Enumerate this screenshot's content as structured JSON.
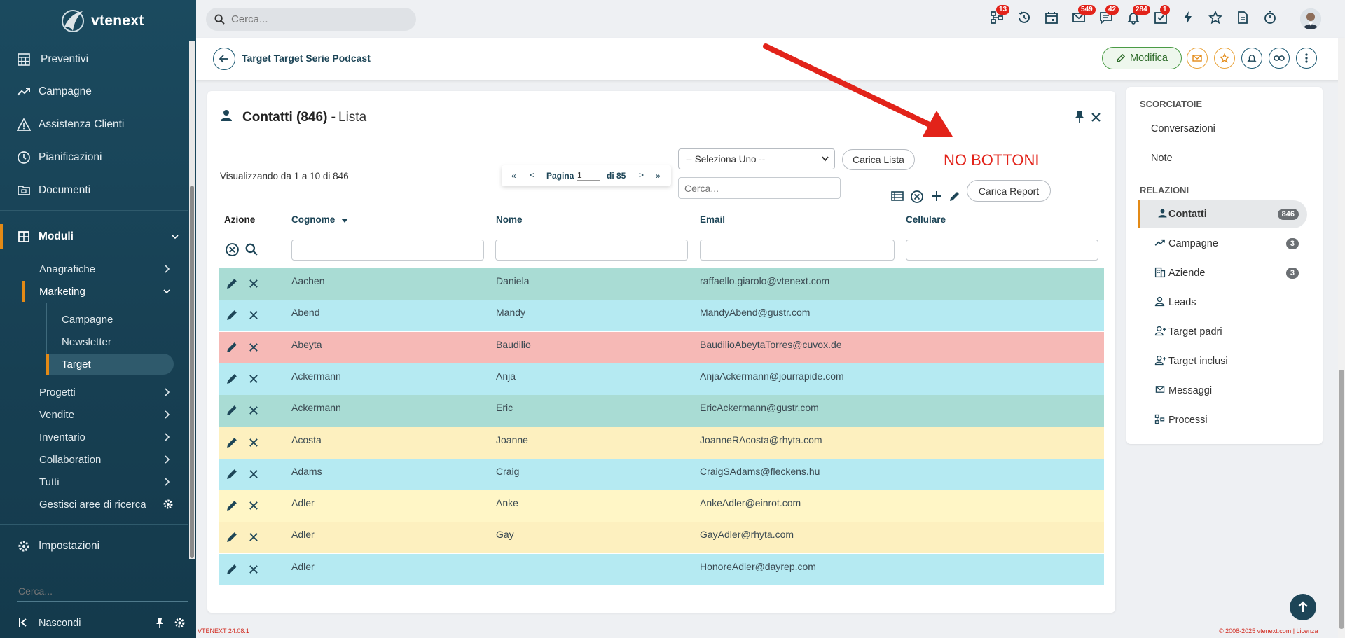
{
  "sidebar": {
    "logo": "vtenext",
    "items": [
      {
        "label": "Preventivi"
      },
      {
        "label": "Campagne"
      },
      {
        "label": "Assistenza Clienti"
      },
      {
        "label": "Pianificazioni"
      },
      {
        "label": "Documenti"
      },
      {
        "label": "Moduli"
      },
      {
        "label": "Impostazioni"
      }
    ],
    "moduli_sub": [
      {
        "label": "Anagrafiche"
      },
      {
        "label": "Marketing"
      },
      {
        "label": "Progetti"
      },
      {
        "label": "Vendite"
      },
      {
        "label": "Inventario"
      },
      {
        "label": "Collaboration"
      },
      {
        "label": "Tutti"
      },
      {
        "label": "Gestisci aree di ricerca"
      }
    ],
    "marketing_sub": [
      {
        "label": "Campagne"
      },
      {
        "label": "Newsletter"
      },
      {
        "label": "Target"
      }
    ],
    "search_placeholder": "Cerca...",
    "hide_label": "Nascondi",
    "active_color": "#e38a16"
  },
  "topbar": {
    "search_placeholder": "Cerca...",
    "badges": {
      "processes": "13",
      "mail": "549",
      "chat": "42",
      "notifications": "284",
      "tasks": "1"
    }
  },
  "record": {
    "title": "Target Target Serie Podcast",
    "edit_label": "Modifica"
  },
  "panel": {
    "title": "Contatti (846) -",
    "title_suffix": "Lista",
    "showing": "Visualizzando da 1 a 10 di 846",
    "pager": {
      "first": "«",
      "prev": "<",
      "label": "Pagina",
      "page": "1",
      "of": "di 85",
      "next": ">",
      "last": "»"
    },
    "select_placeholder": "-- Seleziona Uno --",
    "load_list": "Carica Lista",
    "search_placeholder": "Cerca...",
    "load_report": "Carica Report",
    "annotation": "NO BOTTONI",
    "annotation_color": "#e2231a"
  },
  "table": {
    "headers": {
      "action": "Azione",
      "surname": "Cognome",
      "name": "Nome",
      "email": "Email",
      "mobile": "Cellulare"
    },
    "rows": [
      {
        "surname": "Aachen",
        "name": "Daniela",
        "email": "raffaello.giarolo@vtenext.com",
        "mobile": "",
        "color": "#a9dcd4"
      },
      {
        "surname": "Abend",
        "name": "Mandy",
        "email": "MandyAbend@gustr.com",
        "mobile": "",
        "color": "#b5eaf2"
      },
      {
        "surname": "Abeyta",
        "name": "Baudilio",
        "email": "BaudilioAbeytaTorres@cuvox.de",
        "mobile": "",
        "color": "#f6b9b6"
      },
      {
        "surname": "Ackermann",
        "name": "Anja",
        "email": "AnjaAckermann@jourrapide.com",
        "mobile": "",
        "color": "#b5eaf2"
      },
      {
        "surname": "Ackermann",
        "name": "Eric",
        "email": "EricAckermann@gustr.com",
        "mobile": "",
        "color": "#a9dcd4"
      },
      {
        "surname": "Acosta",
        "name": "Joanne",
        "email": "JoanneRAcosta@rhyta.com",
        "mobile": "",
        "color": "#fdf0bf"
      },
      {
        "surname": "Adams",
        "name": "Craig",
        "email": "CraigSAdams@fleckens.hu",
        "mobile": "",
        "color": "#b5eaf2"
      },
      {
        "surname": "Adler",
        "name": "Anke",
        "email": "AnkeAdler@einrot.com",
        "mobile": "",
        "color": "#fff6c6"
      },
      {
        "surname": "Adler",
        "name": "Gay",
        "email": "GayAdler@rhyta.com",
        "mobile": "",
        "color": "#fdf0bf"
      },
      {
        "surname": "Adler",
        "name": "",
        "email": "HonoreAdler@dayrep.com",
        "mobile": "",
        "color": "#b5eaf2"
      }
    ]
  },
  "right": {
    "shortcuts_title": "SCORCIATOIE",
    "shortcuts": [
      {
        "label": "Conversazioni"
      },
      {
        "label": "Note"
      }
    ],
    "relations_title": "RELAZIONI",
    "relations": [
      {
        "label": "Contatti",
        "count": "846"
      },
      {
        "label": "Campagne",
        "count": "3"
      },
      {
        "label": "Aziende",
        "count": "3"
      },
      {
        "label": "Leads",
        "count": ""
      },
      {
        "label": "Target padri",
        "count": ""
      },
      {
        "label": "Target inclusi",
        "count": ""
      },
      {
        "label": "Messaggi",
        "count": ""
      },
      {
        "label": "Processi",
        "count": ""
      }
    ]
  },
  "footer": {
    "version": "VTENEXT 24.08.1",
    "copyright": "© 2008-2025 vtenext.com | Licenza"
  }
}
